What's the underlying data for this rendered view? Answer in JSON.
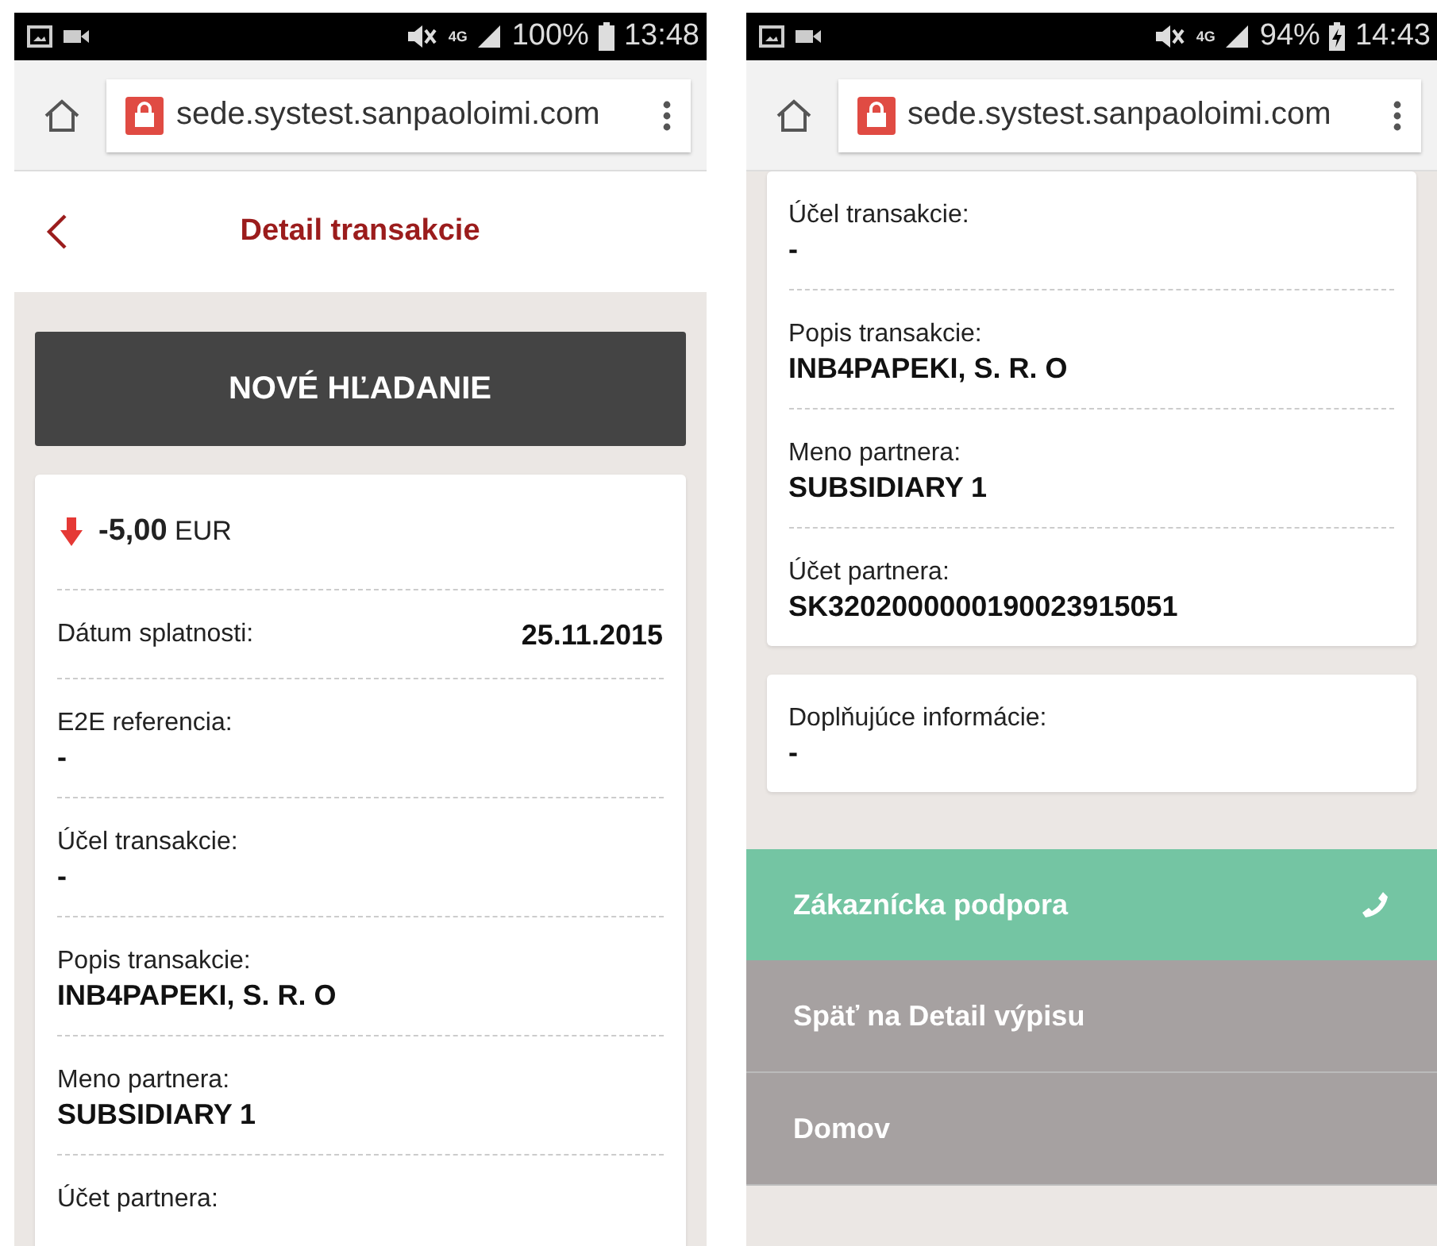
{
  "phones": [
    {
      "status_bar": {
        "network": "4G",
        "battery": "100%",
        "charging": false,
        "time": "13:48"
      },
      "browser": {
        "url": "sede.systest.sanpaoloimi.com"
      },
      "sections": [
        {
          "kind": "header",
          "title": "Detail transakcie"
        },
        {
          "kind": "button",
          "label": "NOVÉ HĽADANIE"
        },
        {
          "kind": "card",
          "fields": [
            {
              "kind": "amount",
              "value": "-5,00",
              "currency": "EUR"
            },
            {
              "kind": "inline",
              "label": "Dátum splatnosti:",
              "value": "25.11.2015"
            },
            {
              "kind": "stacked",
              "label": "E2E referencia:",
              "value": "-"
            },
            {
              "kind": "stacked",
              "label": "Účel transakcie:",
              "value": "-"
            },
            {
              "kind": "stacked",
              "label": "Popis transakcie:",
              "value": "INB4PAPEKI, S. R. O"
            },
            {
              "kind": "stacked",
              "label": "Meno partnera:",
              "value": "SUBSIDIARY 1"
            },
            {
              "kind": "stacked",
              "label": "Účet partnera:"
            }
          ]
        }
      ]
    },
    {
      "status_bar": {
        "network": "4G",
        "battery": "94%",
        "charging": true,
        "time": "14:43"
      },
      "browser": {
        "url": "sede.systest.sanpaoloimi.com"
      },
      "sections": [
        {
          "kind": "card",
          "fields": [
            {
              "kind": "stacked",
              "label": "Účel transakcie:",
              "value": "-"
            },
            {
              "kind": "stacked",
              "label": "Popis transakcie:",
              "value": "INB4PAPEKI, S. R. O"
            },
            {
              "kind": "stacked",
              "label": "Meno partnera:",
              "value": "SUBSIDIARY 1"
            },
            {
              "kind": "stacked",
              "label": "Účet partnera:",
              "value": "SK3202000000190023915051"
            }
          ]
        },
        {
          "kind": "card",
          "fields": [
            {
              "kind": "stacked",
              "label": "Doplňujúce informácie:",
              "value": "-"
            }
          ]
        },
        {
          "kind": "menu",
          "items": [
            {
              "label": "Zákaznícka podpora",
              "kind": "support"
            },
            {
              "label": "Späť na Detail výpisu",
              "kind": "link"
            },
            {
              "label": "Domov",
              "kind": "link"
            }
          ]
        }
      ]
    }
  ]
}
